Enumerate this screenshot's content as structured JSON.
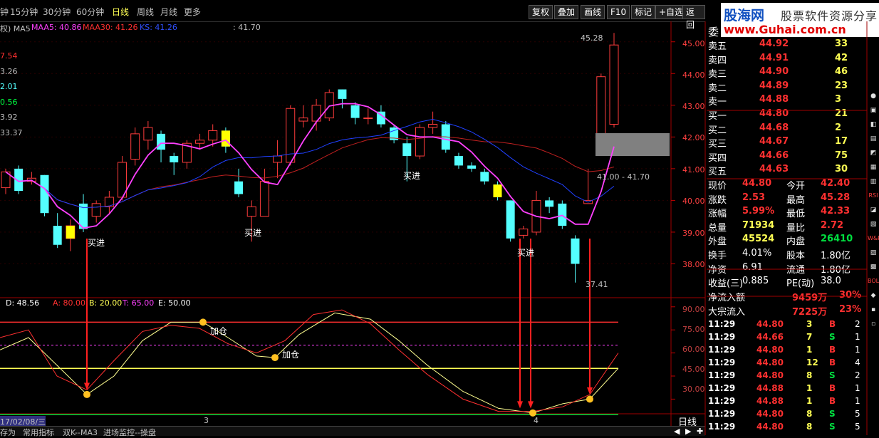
{
  "toolbar": {
    "periods": [
      "15分钟",
      "30分钟",
      "60分钟",
      "日线",
      "周线",
      "月线",
      "更多"
    ],
    "active_period": "日线",
    "buttons": [
      "复权",
      "叠加",
      "画线",
      "F10",
      "标记",
      "+自选",
      "返回"
    ]
  },
  "logo": {
    "name": "股海网",
    "slogan": "股票软件资源分享",
    "url": "www.Guhai.com.cn"
  },
  "main_legend": {
    "prefix": "权) MA5",
    "maa5": "MAA5: 40.86",
    "maa30": "MAA30: 41.26",
    "ks": "KS: 41.26",
    "value": ": 41.70"
  },
  "left_values": [
    "7.54",
    "3.26",
    "2.01",
    "0.56",
    "3.92",
    "33.37"
  ],
  "price_axis": [
    "45.00",
    "44.00",
    "43.00",
    "42.00",
    "41.00",
    "40.00",
    "39.00",
    "38.00"
  ],
  "high_label": "45.28",
  "low_label": "37.41",
  "range_label": "41.00 - 41.70",
  "buy_labels": [
    "买进",
    "买进",
    "买进",
    "买进"
  ],
  "osc_legend": {
    "d": "D: 48.56",
    "a": "A: 80.00",
    "b": "B: 20.00",
    "t": "T: 65.00",
    "e": "E: 50.00"
  },
  "osc_axis": [
    "90.00",
    "75.00",
    "60.00",
    "45.00",
    "30.00"
  ],
  "add_labels": [
    "加仓",
    "加仓"
  ],
  "date_labels": [
    "17/02/08/三",
    "3",
    "4"
  ],
  "bottom_tabs": [
    "存为",
    "常用指标",
    "双K--MA3",
    "进场监控--操盘"
  ],
  "period_tag": "日线",
  "chart_data": [
    {
      "type": "candlestick",
      "ylim": [
        37.0,
        45.6
      ],
      "candles": [
        {
          "o": 40.4,
          "c": 40.9,
          "h": 41.0,
          "l": 40.2
        },
        {
          "o": 41.0,
          "c": 40.3,
          "h": 41.1,
          "l": 40.2
        },
        {
          "o": 40.6,
          "c": 40.7,
          "h": 40.9,
          "l": 40.5
        },
        {
          "o": 40.8,
          "c": 39.6,
          "h": 40.8,
          "l": 39.5
        },
        {
          "o": 39.2,
          "c": 38.6,
          "h": 39.6,
          "l": 38.5
        },
        {
          "o": 38.8,
          "c": 39.2,
          "h": 39.4,
          "l": 38.4
        },
        {
          "o": 39.9,
          "c": 39.1,
          "h": 40.2,
          "l": 39.0
        },
        {
          "o": 39.5,
          "c": 39.9,
          "h": 40.0,
          "l": 39.3
        },
        {
          "o": 39.8,
          "c": 40.1,
          "h": 40.3,
          "l": 39.6
        },
        {
          "o": 40.1,
          "c": 41.2,
          "h": 41.4,
          "l": 40.0
        },
        {
          "o": 41.3,
          "c": 42.1,
          "h": 42.3,
          "l": 41.1
        },
        {
          "o": 41.9,
          "c": 42.3,
          "h": 42.5,
          "l": 41.6
        },
        {
          "o": 42.1,
          "c": 41.6,
          "h": 42.2,
          "l": 41.2
        },
        {
          "o": 41.4,
          "c": 41.2,
          "h": 41.5,
          "l": 40.8
        },
        {
          "o": 41.2,
          "c": 41.8,
          "h": 41.9,
          "l": 41.0
        },
        {
          "o": 41.8,
          "c": 41.9,
          "h": 42.1,
          "l": 41.6
        },
        {
          "o": 41.9,
          "c": 42.2,
          "h": 42.4,
          "l": 41.7
        },
        {
          "o": 42.2,
          "c": 41.7,
          "h": 42.3,
          "l": 41.5
        },
        {
          "o": 40.6,
          "c": 40.2,
          "h": 41.0,
          "l": 40.1
        },
        {
          "o": 39.5,
          "c": 39.8,
          "h": 40.0,
          "l": 38.7
        },
        {
          "o": 39.5,
          "c": 40.6,
          "h": 41.0,
          "l": 39.5
        },
        {
          "o": 41.2,
          "c": 41.4,
          "h": 41.9,
          "l": 40.7
        },
        {
          "o": 41.2,
          "c": 42.9,
          "h": 43.0,
          "l": 41.1
        },
        {
          "o": 42.5,
          "c": 42.6,
          "h": 43.0,
          "l": 42.3
        },
        {
          "o": 42.5,
          "c": 43.0,
          "h": 43.2,
          "l": 42.2
        },
        {
          "o": 42.6,
          "c": 43.4,
          "h": 43.5,
          "l": 42.5
        },
        {
          "o": 43.5,
          "c": 43.2,
          "h": 43.5,
          "l": 42.9
        },
        {
          "o": 43.0,
          "c": 42.6,
          "h": 43.1,
          "l": 42.4
        },
        {
          "o": 42.6,
          "c": 42.6,
          "h": 42.9,
          "l": 42.4
        },
        {
          "o": 42.8,
          "c": 42.4,
          "h": 43.0,
          "l": 42.3
        },
        {
          "o": 42.3,
          "c": 41.9,
          "h": 42.4,
          "l": 41.8
        },
        {
          "o": 41.8,
          "c": 41.4,
          "h": 42.0,
          "l": 40.6
        },
        {
          "o": 41.4,
          "c": 42.3,
          "h": 42.4,
          "l": 41.3
        },
        {
          "o": 42.3,
          "c": 42.4,
          "h": 42.8,
          "l": 42.1
        },
        {
          "o": 42.4,
          "c": 41.6,
          "h": 42.5,
          "l": 41.5
        },
        {
          "o": 41.4,
          "c": 41.1,
          "h": 41.5,
          "l": 41.0
        },
        {
          "o": 41.1,
          "c": 41.0,
          "h": 41.2,
          "l": 40.9
        },
        {
          "o": 40.9,
          "c": 40.6,
          "h": 41.0,
          "l": 40.5
        },
        {
          "o": 40.5,
          "c": 40.1,
          "h": 40.6,
          "l": 40.0
        },
        {
          "o": 40.0,
          "c": 38.8,
          "h": 40.0,
          "l": 38.7
        },
        {
          "o": 38.9,
          "c": 39.1,
          "h": 39.2,
          "l": 38.8
        },
        {
          "o": 39.0,
          "c": 40.0,
          "h": 40.3,
          "l": 38.9
        },
        {
          "o": 40.0,
          "c": 39.8,
          "h": 40.1,
          "l": 39.6
        },
        {
          "o": 39.9,
          "c": 39.2,
          "h": 40.0,
          "l": 39.1
        },
        {
          "o": 38.8,
          "c": 38.0,
          "h": 38.9,
          "l": 37.41
        },
        {
          "o": 39.9,
          "c": 40.0,
          "h": 41.0,
          "l": 39.9
        },
        {
          "o": 42.0,
          "c": 43.9,
          "h": 44.0,
          "l": 41.8
        },
        {
          "o": 42.4,
          "c": 44.9,
          "h": 45.28,
          "l": 42.3
        }
      ],
      "buy_signals": [
        5,
        17,
        38
      ],
      "ma_lines": [
        "MAA5",
        "MAA30",
        "KS"
      ]
    },
    {
      "type": "line",
      "ylim": [
        20,
        95
      ],
      "series": [
        {
          "name": "D"
        },
        {
          "name": "A"
        },
        {
          "name": "B"
        },
        {
          "name": "T"
        },
        {
          "name": "E"
        }
      ]
    }
  ],
  "quote": {
    "header": "委",
    "asks": [
      {
        "label": "卖五",
        "price": "44.92",
        "vol": "33"
      },
      {
        "label": "卖四",
        "price": "44.91",
        "vol": "42"
      },
      {
        "label": "卖三",
        "price": "44.90",
        "vol": "46"
      },
      {
        "label": "卖二",
        "price": "44.89",
        "vol": "23"
      },
      {
        "label": "卖一",
        "price": "44.88",
        "vol": "3"
      }
    ],
    "bids": [
      {
        "label": "买一",
        "price": "44.80",
        "vol": "21"
      },
      {
        "label": "买二",
        "price": "44.68",
        "vol": "2"
      },
      {
        "label": "买三",
        "price": "44.67",
        "vol": "17"
      },
      {
        "label": "买四",
        "price": "44.66",
        "vol": "75"
      },
      {
        "label": "买五",
        "price": "44.63",
        "vol": "30"
      }
    ],
    "stats": [
      {
        "l1": "现价",
        "v1": "44.80",
        "l2": "今开",
        "v2": "42.40"
      },
      {
        "l1": "涨跌",
        "v1": "2.53",
        "l2": "最高",
        "v2": "45.28"
      },
      {
        "l1": "涨幅",
        "v1": "5.99%",
        "l2": "最低",
        "v2": "42.33"
      },
      {
        "l1": "总量",
        "v1": "71934",
        "l2": "量比",
        "v2": "2.72"
      },
      {
        "l1": "外盘",
        "v1": "45524",
        "l2": "内盘",
        "v2": "26410"
      },
      {
        "l1": "换手",
        "v1": "4.01%",
        "l2": "股本",
        "v2": "1.80亿"
      },
      {
        "l1": "净资",
        "v1": "6.91",
        "l2": "流通",
        "v2": "1.80亿"
      },
      {
        "l1": "收益(三)",
        "v1": "0.885",
        "l2": "PE(动)",
        "v2": "38.0"
      }
    ],
    "flow": [
      {
        "label": "净流入额",
        "val": "9459万",
        "pct": "30%"
      },
      {
        "label": "大宗流入",
        "val": "7225万",
        "pct": "23%"
      }
    ],
    "ticks": [
      {
        "t": "11:29",
        "p": "44.80",
        "v": "3",
        "s": "B",
        "n": "2"
      },
      {
        "t": "11:29",
        "p": "44.66",
        "v": "7",
        "s": "S",
        "n": "1"
      },
      {
        "t": "11:29",
        "p": "44.80",
        "v": "1",
        "s": "B",
        "n": "1"
      },
      {
        "t": "11:29",
        "p": "44.80",
        "v": "12",
        "s": "B",
        "n": "4"
      },
      {
        "t": "11:29",
        "p": "44.80",
        "v": "8",
        "s": "S",
        "n": "2"
      },
      {
        "t": "11:29",
        "p": "44.88",
        "v": "1",
        "s": "B",
        "n": "1"
      },
      {
        "t": "11:29",
        "p": "44.88",
        "v": "1",
        "s": "B",
        "n": "1"
      },
      {
        "t": "11:29",
        "p": "44.80",
        "v": "8",
        "s": "S",
        "n": "5"
      },
      {
        "t": "11:29",
        "p": "44.80",
        "v": "8",
        "s": "S",
        "n": "5"
      }
    ]
  },
  "right_bar": [
    "RSI",
    "W&R",
    "BOLL"
  ],
  "colors": {
    "up": "#ff3c3c",
    "down": "#54ffff",
    "buy": "#ffff00",
    "ma_short": "#ff40ff",
    "ma_long": "#c02020",
    "ks": "#2040ff"
  }
}
